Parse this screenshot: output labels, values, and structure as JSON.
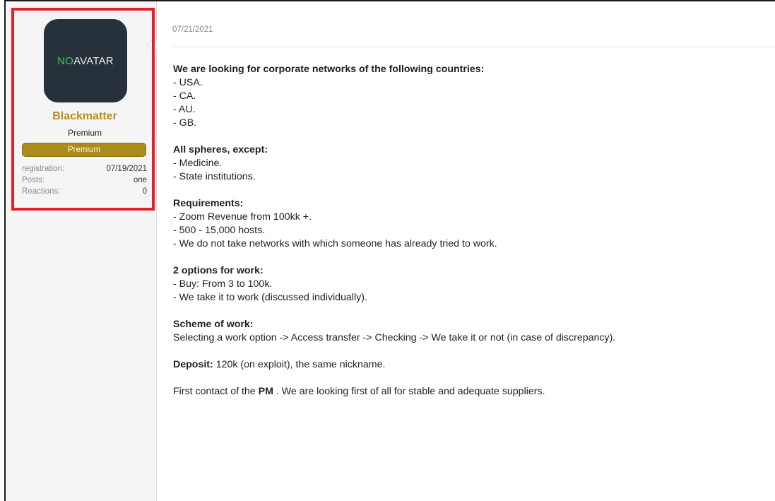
{
  "user": {
    "avatar_text_1": "NO",
    "avatar_text_2": " AVATAR",
    "username": "Blackmatter",
    "user_title": "Premium",
    "badge": "Premium",
    "stats": [
      {
        "label": "registration:",
        "value": "07/19/2021"
      },
      {
        "label": "Posts:",
        "value": "one"
      },
      {
        "label": "Reactions:",
        "value": "0"
      }
    ]
  },
  "post": {
    "date": "07/21/2021",
    "countries": {
      "heading": "We are looking for corporate networks of the following countries:",
      "items": [
        "- USA.",
        "- CA.",
        "- AU.",
        "- GB."
      ]
    },
    "spheres": {
      "heading": "All spheres, except:",
      "items": [
        "- Medicine.",
        "- State institutions."
      ]
    },
    "requirements": {
      "heading": "Requirements:",
      "items": [
        "- Zoom Revenue from 100kk +.",
        "- 500 - 15,000 hosts.",
        "- We do not take networks with which someone has already tried to work."
      ]
    },
    "options": {
      "heading": "2 options for work:",
      "items": [
        "- Buy: From 3 to 100k.",
        "- We take it to work (discussed individually)."
      ]
    },
    "scheme": {
      "heading": "Scheme of work:",
      "text": "Selecting a work option -> Access transfer -> Checking -> We take it or not (in case of discrepancy)."
    },
    "deposit": {
      "label": "Deposit:",
      "text": " 120k (on exploit), the same nickname."
    },
    "contact": {
      "text_before": "First contact of the ",
      "bold": "PM",
      "text_after": " . We are looking first of all for stable and adequate suppliers."
    }
  },
  "colors": {
    "highlight_border": "#e3202a",
    "username": "#b09023",
    "badge": "#ab8b19",
    "avatar_bg": "#273139",
    "avatar_no": "#37c95e"
  }
}
